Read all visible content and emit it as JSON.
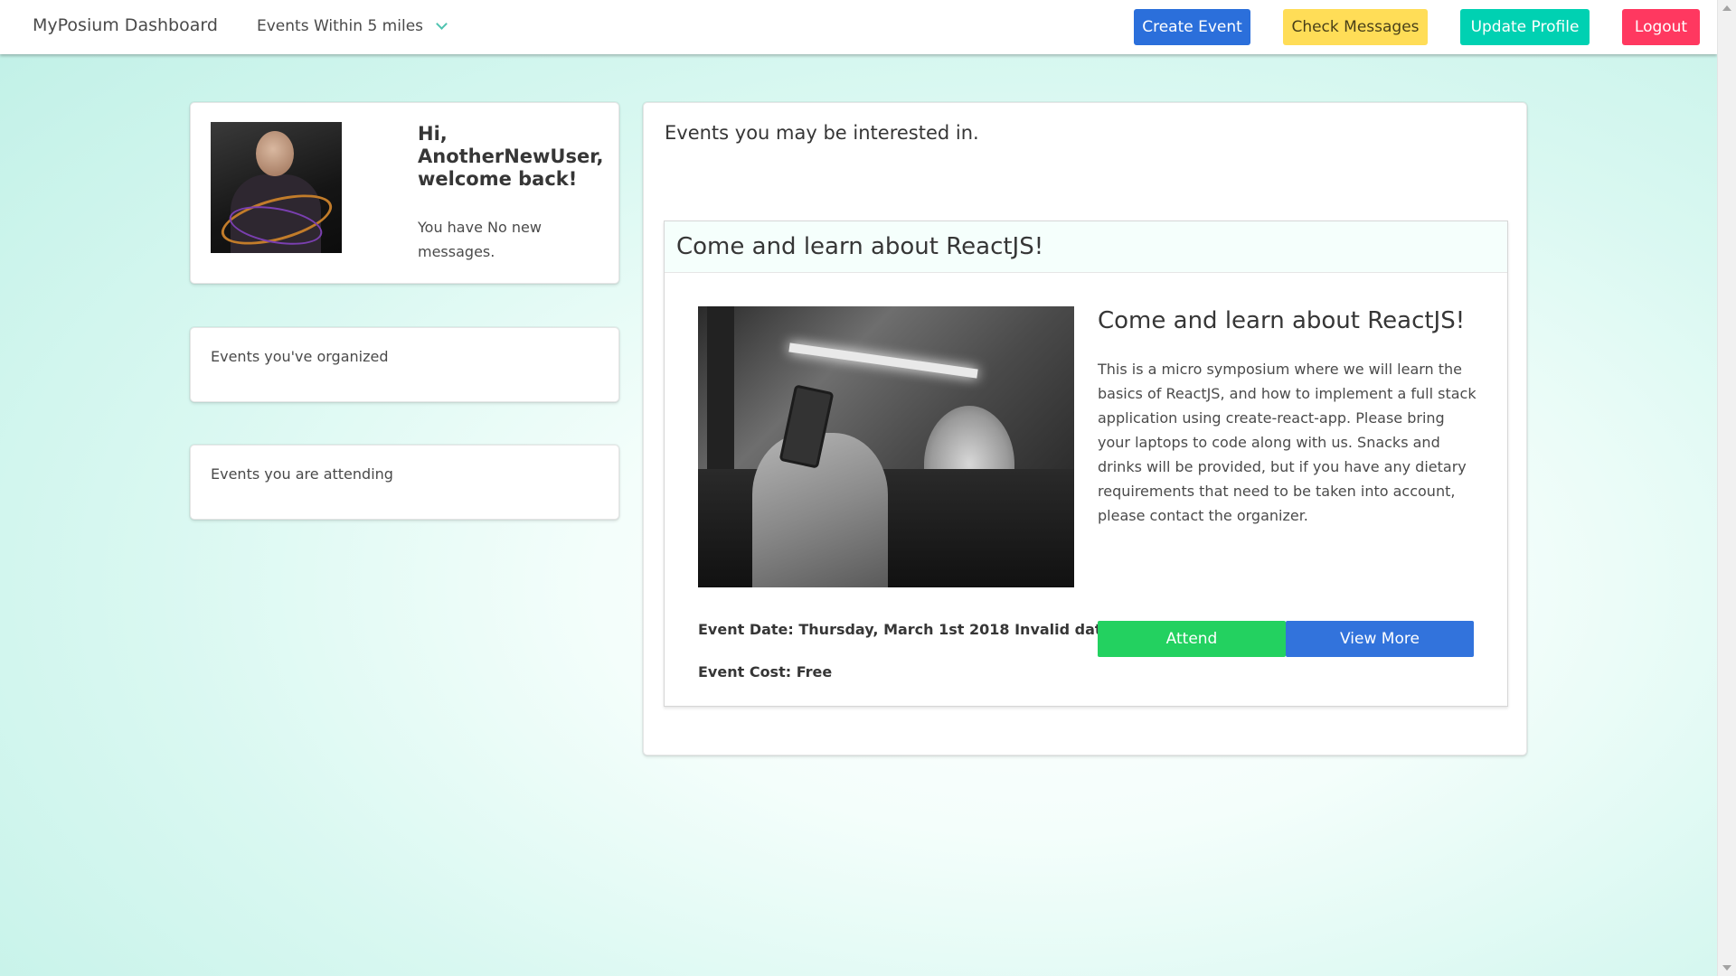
{
  "navbar": {
    "brand": "MyPosium Dashboard",
    "filter_label": "Events Within 5 miles",
    "buttons": {
      "create_event": "Create Event",
      "check_messages": "Check Messages",
      "update_profile": "Update Profile",
      "logout": "Logout"
    }
  },
  "profile": {
    "greeting": "Hi, AnotherNewUser, welcome back!",
    "messages_note": "You have No new messages."
  },
  "sidebar": {
    "organized_label": "Events you've organized",
    "attending_label": "Events you are attending"
  },
  "events": {
    "heading": "Events you may be interested in.",
    "items": [
      {
        "header_title": "Come and learn about ReactJS!",
        "title": "Come and learn about ReactJS!",
        "description": "This is a micro symposium where we will learn the basics of ReactJS, and how to implement a full stack application using create-react-app. Please bring your laptops to code along with us. Snacks and drinks will be provided, but if you have any dietary requirements that need to be taken into account, please contact the organizer.",
        "date_text": "Event Date: Thursday, March 1st 2018 Invalid date",
        "cost_text": "Event Cost: Free",
        "attend_label": "Attend",
        "view_more_label": "View More"
      }
    ]
  },
  "colors": {
    "create_event": "#2b6fdb",
    "check_messages": "#ffdd57",
    "update_profile": "#00d1b2",
    "logout": "#ff3860",
    "attend": "#23d160",
    "view_more": "#3273dc"
  }
}
